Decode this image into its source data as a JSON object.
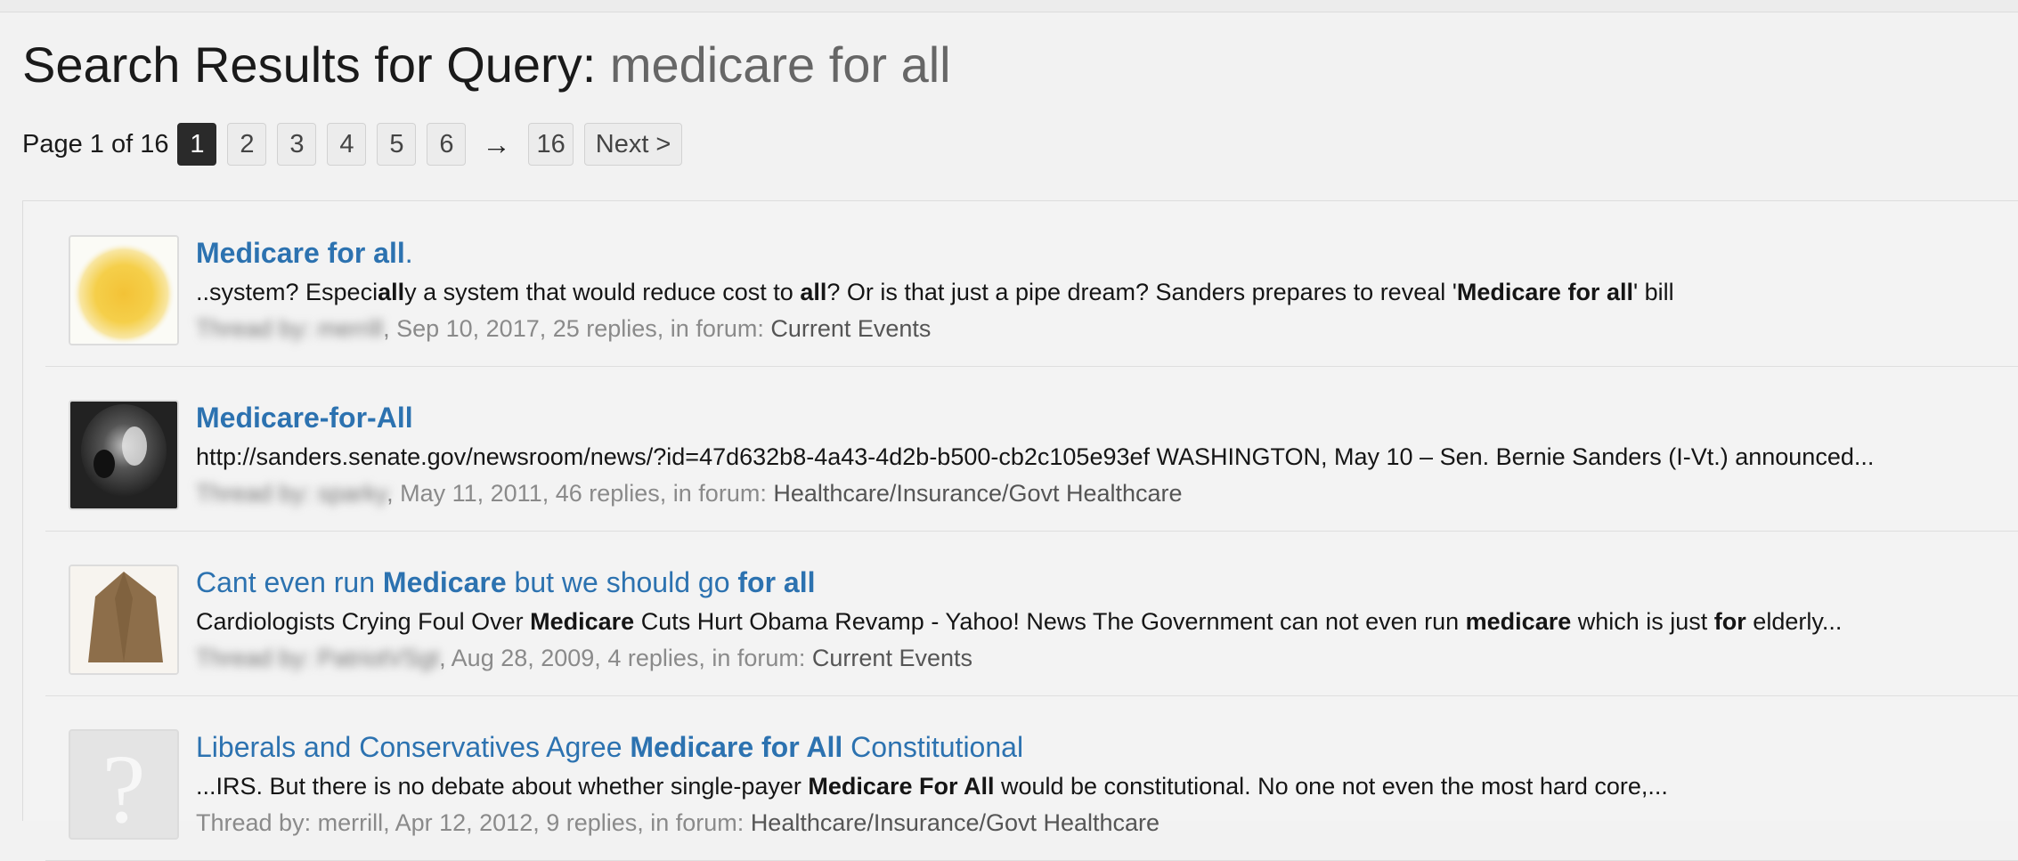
{
  "header": {
    "title_prefix": "Search Results for Query: ",
    "query": "medicare for all"
  },
  "pagination": {
    "label": "Page 1 of 16",
    "pages": [
      "1",
      "2",
      "3",
      "4",
      "5",
      "6"
    ],
    "current": "1",
    "arrow": "→",
    "last": "16",
    "next_label": "Next >"
  },
  "results": [
    {
      "title_parts": [
        {
          "t": "Medicare for all",
          "b": true
        },
        {
          "t": ".",
          "b": false
        }
      ],
      "snippet_parts": [
        {
          "t": "..system? Especi",
          "b": false
        },
        {
          "t": "all",
          "b": true
        },
        {
          "t": "y a system that would reduce cost to ",
          "b": false
        },
        {
          "t": "all",
          "b": true
        },
        {
          "t": "? Or is that just a pipe dream? Sanders prepares to reveal '",
          "b": false
        },
        {
          "t": "Medicare for all",
          "b": true
        },
        {
          "t": "' bill",
          "b": false
        }
      ],
      "meta": {
        "prefix": "Thread by: ",
        "author": "merrill",
        "details": ", Sep 10, 2017, 25 replies, in forum: ",
        "forum": "Current Events"
      },
      "thumb": "sun-avatar"
    },
    {
      "title_parts": [
        {
          "t": "Medicare-for-All",
          "b": true
        }
      ],
      "snippet_parts": [
        {
          "t": "http://sanders.senate.gov/newsroom/news/?id=47d632b8-4a43-4d2b-b500-cb2c105e93ef WASHINGTON, May 10 – Sen. Bernie Sanders (I-Vt.) announced...",
          "b": false
        }
      ],
      "meta": {
        "prefix": "Thread by: ",
        "author": "sparky",
        "details": ", May 11, 2011, 46 replies, in forum: ",
        "forum": "Healthcare/Insurance/Govt Healthcare"
      },
      "thumb": "bw-photo-avatar"
    },
    {
      "title_parts": [
        {
          "t": "Cant even run ",
          "b": false
        },
        {
          "t": "Medicare",
          "b": true
        },
        {
          "t": " but we should go ",
          "b": false
        },
        {
          "t": "for all",
          "b": true
        }
      ],
      "snippet_parts": [
        {
          "t": "Cardiologists Crying Foul Over ",
          "b": false
        },
        {
          "t": "Medicare",
          "b": true
        },
        {
          "t": " Cuts Hurt Obama Revamp - Yahoo! News The Government can not even run ",
          "b": false
        },
        {
          "t": "medicare",
          "b": true
        },
        {
          "t": " which is just ",
          "b": false
        },
        {
          "t": "for",
          "b": true
        },
        {
          "t": " elderly...",
          "b": false
        }
      ],
      "meta": {
        "prefix": "Thread by: ",
        "author": "PatriotVSgt",
        "details": ", Aug 28, 2009, 4 replies, in forum: ",
        "forum": "Current Events"
      },
      "thumb": "brown-avatar"
    },
    {
      "title_parts": [
        {
          "t": "Liberals and Conservatives Agree ",
          "b": false
        },
        {
          "t": "Medicare for All",
          "b": true
        },
        {
          "t": " Constitutional",
          "b": false
        }
      ],
      "snippet_parts": [
        {
          "t": "...IRS. But there is no debate about whether single-payer ",
          "b": false
        },
        {
          "t": "Medicare For All",
          "b": true
        },
        {
          "t": " would be constitutional. No one  not even the most hard core,...",
          "b": false
        }
      ],
      "meta": {
        "prefix": "Thread by: ",
        "author": "merrill",
        "details": ", Apr 12, 2012, 9 replies, in forum: ",
        "forum": "Healthcare/Insurance/Govt Healthcare"
      },
      "thumb": "placeholder-avatar"
    }
  ],
  "colors": {
    "link": "#2c72b0",
    "active_page": "#2a2a2a",
    "meta": "#8a8a8a"
  }
}
